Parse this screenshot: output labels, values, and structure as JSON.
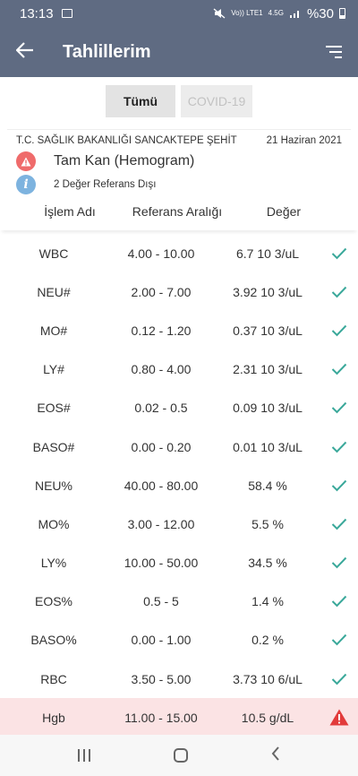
{
  "status_bar": {
    "time": "13:13",
    "carrier": "Vo)) LTE1",
    "network": "4.5G",
    "battery": "%30"
  },
  "app_bar": {
    "title": "Tahlillerim",
    "back_icon": "arrow-left-icon",
    "filter_icon": "filter-icon"
  },
  "segments": [
    {
      "label": "Tümü",
      "active": true
    },
    {
      "label": "COVID-19",
      "active": false
    }
  ],
  "card": {
    "institution": "T.C. SAĞLIK BAKANLIĞI SANCAKTEPE ŞEHİT",
    "date": "21 Haziran 2021",
    "test_name": "Tam Kan (Hemogram)",
    "info_text": "2 Değer Referans Dışı"
  },
  "table": {
    "headers": [
      "İşlem Adı",
      "Referans Aralığı",
      "Değer"
    ],
    "rows": [
      {
        "name": "WBC",
        "range": "4.00 - 10.00",
        "value": "6.7 10 3/uL",
        "status": "normal"
      },
      {
        "name": "NEU#",
        "range": "2.00 - 7.00",
        "value": "3.92 10 3/uL",
        "status": "normal"
      },
      {
        "name": "MO#",
        "range": "0.12 - 1.20",
        "value": "0.37 10 3/uL",
        "status": "normal"
      },
      {
        "name": "LY#",
        "range": "0.80 - 4.00",
        "value": "2.31 10 3/uL",
        "status": "normal"
      },
      {
        "name": "EOS#",
        "range": "0.02 - 0.5",
        "value": "0.09 10 3/uL",
        "status": "normal"
      },
      {
        "name": "BASO#",
        "range": "0.00 - 0.20",
        "value": "0.01 10 3/uL",
        "status": "normal"
      },
      {
        "name": "NEU%",
        "range": "40.00 - 80.00",
        "value": "58.4 %",
        "status": "normal"
      },
      {
        "name": "MO%",
        "range": "3.00 - 12.00",
        "value": "5.5 %",
        "status": "normal"
      },
      {
        "name": "LY%",
        "range": "10.00 - 50.00",
        "value": "34.5 %",
        "status": "normal"
      },
      {
        "name": "EOS%",
        "range": "0.5 - 5",
        "value": "1.4 %",
        "status": "normal"
      },
      {
        "name": "BASO%",
        "range": "0.00 - 1.00",
        "value": "0.2 %",
        "status": "normal"
      },
      {
        "name": "RBC",
        "range": "3.50 - 5.00",
        "value": "3.73 10 6/uL",
        "status": "normal"
      },
      {
        "name": "Hgb",
        "range": "11.00 - 15.00",
        "value": "10.5 g/dL",
        "status": "abnormal"
      }
    ]
  },
  "colors": {
    "header_bg": "#5f6b82",
    "check": "#3aa89a",
    "warning": "#e23b3b",
    "abnormal_row_bg": "#fbe3e4"
  }
}
